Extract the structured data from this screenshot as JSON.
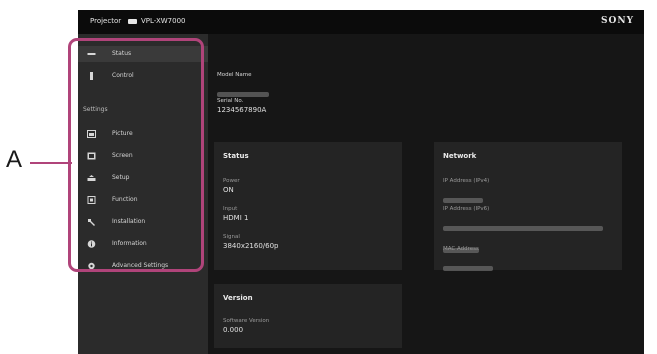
{
  "callout": {
    "letter": "A"
  },
  "topbar": {
    "title": "Projector",
    "model": "VPL-XW7000",
    "brand": "SONY"
  },
  "sidebar": {
    "items": [
      {
        "label": "Status",
        "icon": "status-icon",
        "active": true
      },
      {
        "label": "Control",
        "icon": "remote-icon"
      }
    ],
    "group_label": "Settings",
    "settings_items": [
      {
        "label": "Picture",
        "icon": "picture-icon"
      },
      {
        "label": "Screen",
        "icon": "screen-icon"
      },
      {
        "label": "Setup",
        "icon": "setup-icon"
      },
      {
        "label": "Function",
        "icon": "function-icon"
      },
      {
        "label": "Installation",
        "icon": "wrench-icon"
      },
      {
        "label": "Information",
        "icon": "info-icon"
      },
      {
        "label": "Advanced Settings",
        "icon": "gear-icon"
      }
    ]
  },
  "main": {
    "model_name_label": "Model Name",
    "serial_label": "Serial No.",
    "serial_value": "1234567890A",
    "status": {
      "title": "Status",
      "power_label": "Power",
      "power_value": "ON",
      "input_label": "Input",
      "input_value": "HDMI 1",
      "signal_label": "Signal",
      "signal_value": "3840x2160/60p"
    },
    "network": {
      "title": "Network",
      "ipv4_label": "IP Address (IPv4)",
      "ipv6_label": "IP Address (IPv6)",
      "mac_label": "MAC Address"
    },
    "version": {
      "title": "Version",
      "software_label": "Software Version",
      "software_value": "0.000"
    }
  },
  "colors": {
    "highlight": "#b0447a",
    "background": "#151515",
    "sidebar": "#2b2b2b",
    "card": "#242424"
  }
}
